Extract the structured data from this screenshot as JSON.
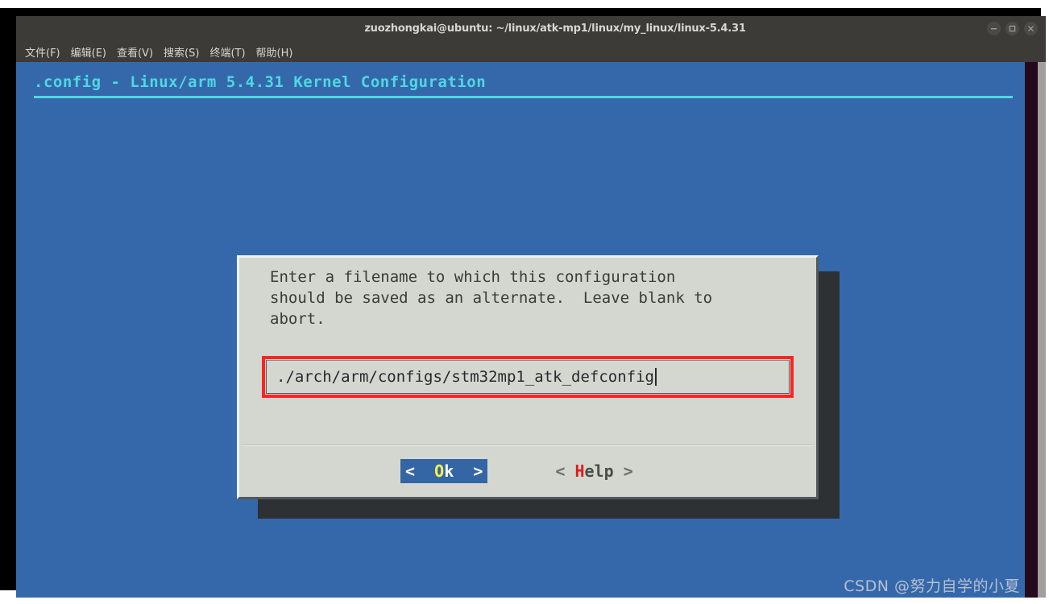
{
  "window": {
    "title": "zuozhongkai@ubuntu: ~/linux/atk-mp1/linux/my_linux/linux-5.4.31",
    "controls": [
      {
        "name": "minimize",
        "label": "—"
      },
      {
        "name": "maximize",
        "label": "□"
      },
      {
        "name": "close",
        "label": "✕"
      }
    ]
  },
  "menubar": {
    "items": [
      {
        "label": "文件(F)"
      },
      {
        "label": "编辑(E)"
      },
      {
        "label": "查看(V)"
      },
      {
        "label": "搜索(S)"
      },
      {
        "label": "终端(T)"
      },
      {
        "label": "帮助(H)"
      }
    ]
  },
  "menuconfig": {
    "header": ".config - Linux/arm 5.4.31 Kernel Configuration",
    "dialog": {
      "prompt_line1": "Enter a filename to which this configuration",
      "prompt_line2": "should be saved as an alternate.  Leave blank to",
      "prompt_line3": "abort.",
      "input": {
        "value": "./arch/arm/configs/stm32mp1_atk_defconfig",
        "placeholder": ""
      },
      "buttons": [
        {
          "name": "ok",
          "open_bracket": "<",
          "hotkey": "O",
          "rest": "k",
          "close_bracket": ">",
          "selected": true
        },
        {
          "name": "help",
          "open_bracket": "<",
          "hotkey": "H",
          "rest": "elp",
          "close_bracket": ">",
          "selected": false
        }
      ]
    }
  },
  "colors": {
    "terminal_blue": "#3468ab",
    "header_cyan": "#4fd8e0",
    "dialog_bg": "#d3d7cf",
    "button_selected": "#3465a4",
    "hotkey_yellow": "#fcf14a",
    "hotkey_red": "#e01b1b",
    "annotation_red": "#fb2323"
  },
  "watermark": {
    "text": "CSDN @努力自学的小夏"
  }
}
